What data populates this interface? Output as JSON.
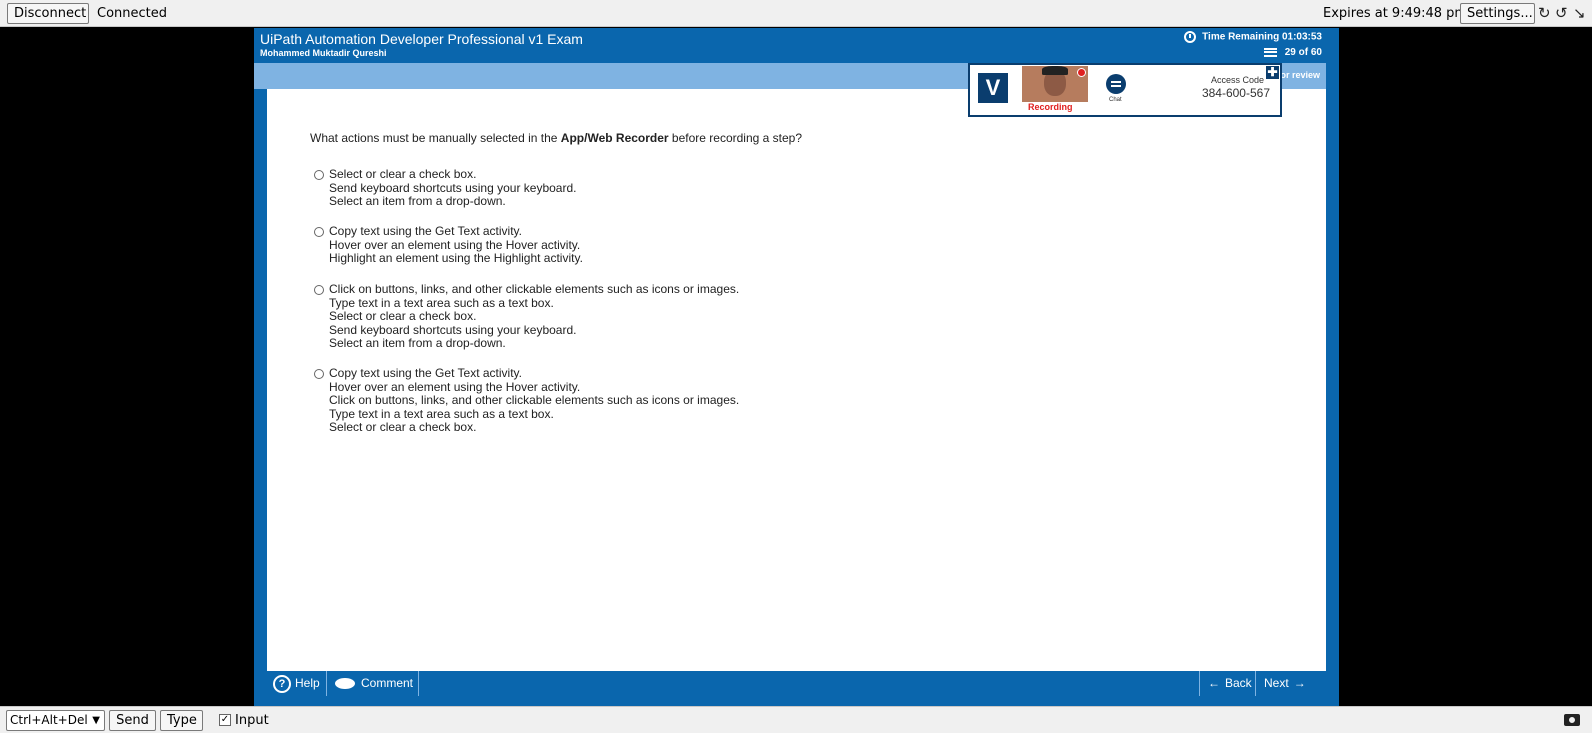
{
  "topbar": {
    "disconnect_label": "Disconnect",
    "status": "Connected",
    "expires": "Expires at 9:49:48 pm",
    "settings_label": "Settings...",
    "icons": [
      "refresh-icon",
      "rotate-icon",
      "collapse-icon"
    ]
  },
  "exam": {
    "title": "UiPath Automation Developer Professional v1 Exam",
    "candidate": "Mohammed Muktadir Qureshi",
    "time_remaining": "Time Remaining 01:03:53",
    "question_count": "29 of 60",
    "mark_for_review": "Mark for review"
  },
  "proctor": {
    "recording_label": "Recording",
    "chat_label": "Chat",
    "access_code_label": "Access Code",
    "access_code": "384-600-567"
  },
  "question": {
    "prefix": "What actions must be manually selected in the ",
    "bold": "App/Web Recorder",
    "suffix": " before recording a step?",
    "options": [
      [
        "Select or clear a check box.",
        "Send keyboard shortcuts using your keyboard.",
        "Select an item from a drop-down."
      ],
      [
        "Copy text using the Get Text activity.",
        "Hover over an element using the Hover activity.",
        "Highlight an element using the Highlight activity."
      ],
      [
        "Click on buttons, links, and other clickable elements such as icons or images.",
        "Type text in a text area such as a text box.",
        "Select or clear a check box.",
        "Send keyboard shortcuts using your keyboard.",
        "Select an item from a drop-down."
      ],
      [
        "Copy text using the Get Text activity.",
        "Hover over an element using the Hover activity.",
        "Click on buttons, links, and other clickable elements such as icons or images.",
        "Type text in a text area such as a text box.",
        "Select or clear a check box."
      ]
    ]
  },
  "footer": {
    "help_label": "Help",
    "comment_label": "Comment",
    "back_label": "Back",
    "next_label": "Next"
  },
  "bottombar": {
    "keys_selected": "Ctrl+Alt+Del",
    "send_label": "Send",
    "type_label": "Type",
    "input_label": "Input"
  }
}
